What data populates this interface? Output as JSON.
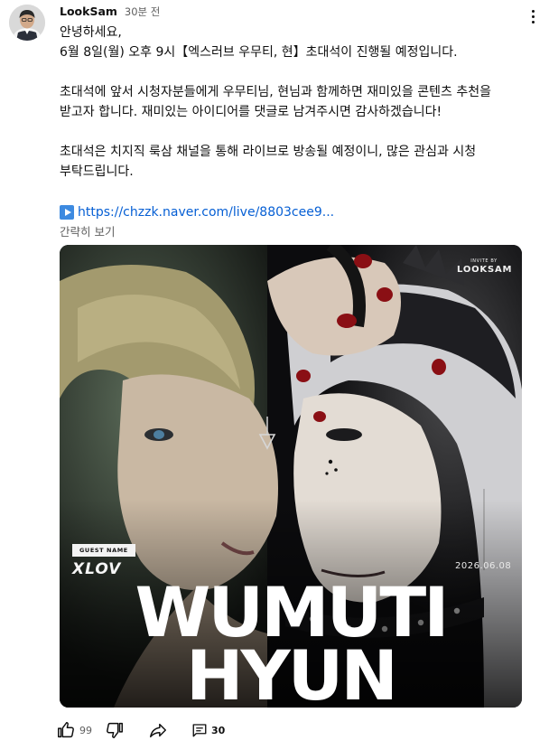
{
  "post": {
    "author": "LookSam",
    "time": "30분 전",
    "lines": {
      "greeting": "안녕하세요,",
      "schedule": "6월 8일(월) 오후 9시【엑스러브 우무티, 현】초대석이 진행될 예정입니다.",
      "request": "초대석에 앞서 시청자분들에게 우무티님, 현님과 함께하면 재미있을 콘텐츠 추천을 받고자 합니다. 재미있는 아이디어를 댓글로 남겨주시면 감사하겠습니다!",
      "broadcast": "초대석은 치지직 룩삼 채널을 통해 라이브로 방송될 예정이니, 많은 관심과 시청 부탁드립니다."
    },
    "link_text": "https://chzzk.naver.com/live/8803cee9...",
    "read_less": "간략히 보기"
  },
  "poster": {
    "invite_label": "INVITE BY",
    "brand": "LOOKSAM",
    "guest_label": "GUEST NAME",
    "guest_group": "XLOV",
    "date": "2026.06.08",
    "title_line1": "WUMUTI",
    "title_line2": "HYUN"
  },
  "actions": {
    "like_count": "99",
    "comment_count": "30"
  },
  "colors": {
    "link": "#065fd4",
    "muted_text": "#606060",
    "play_icon_bg": "#3d8ae0",
    "poster_bg": "#0b0c0e"
  },
  "icons": [
    "avatar",
    "more-vert-icon",
    "play-icon",
    "thumb-up-icon",
    "thumb-down-icon",
    "share-icon",
    "comment-icon"
  ]
}
